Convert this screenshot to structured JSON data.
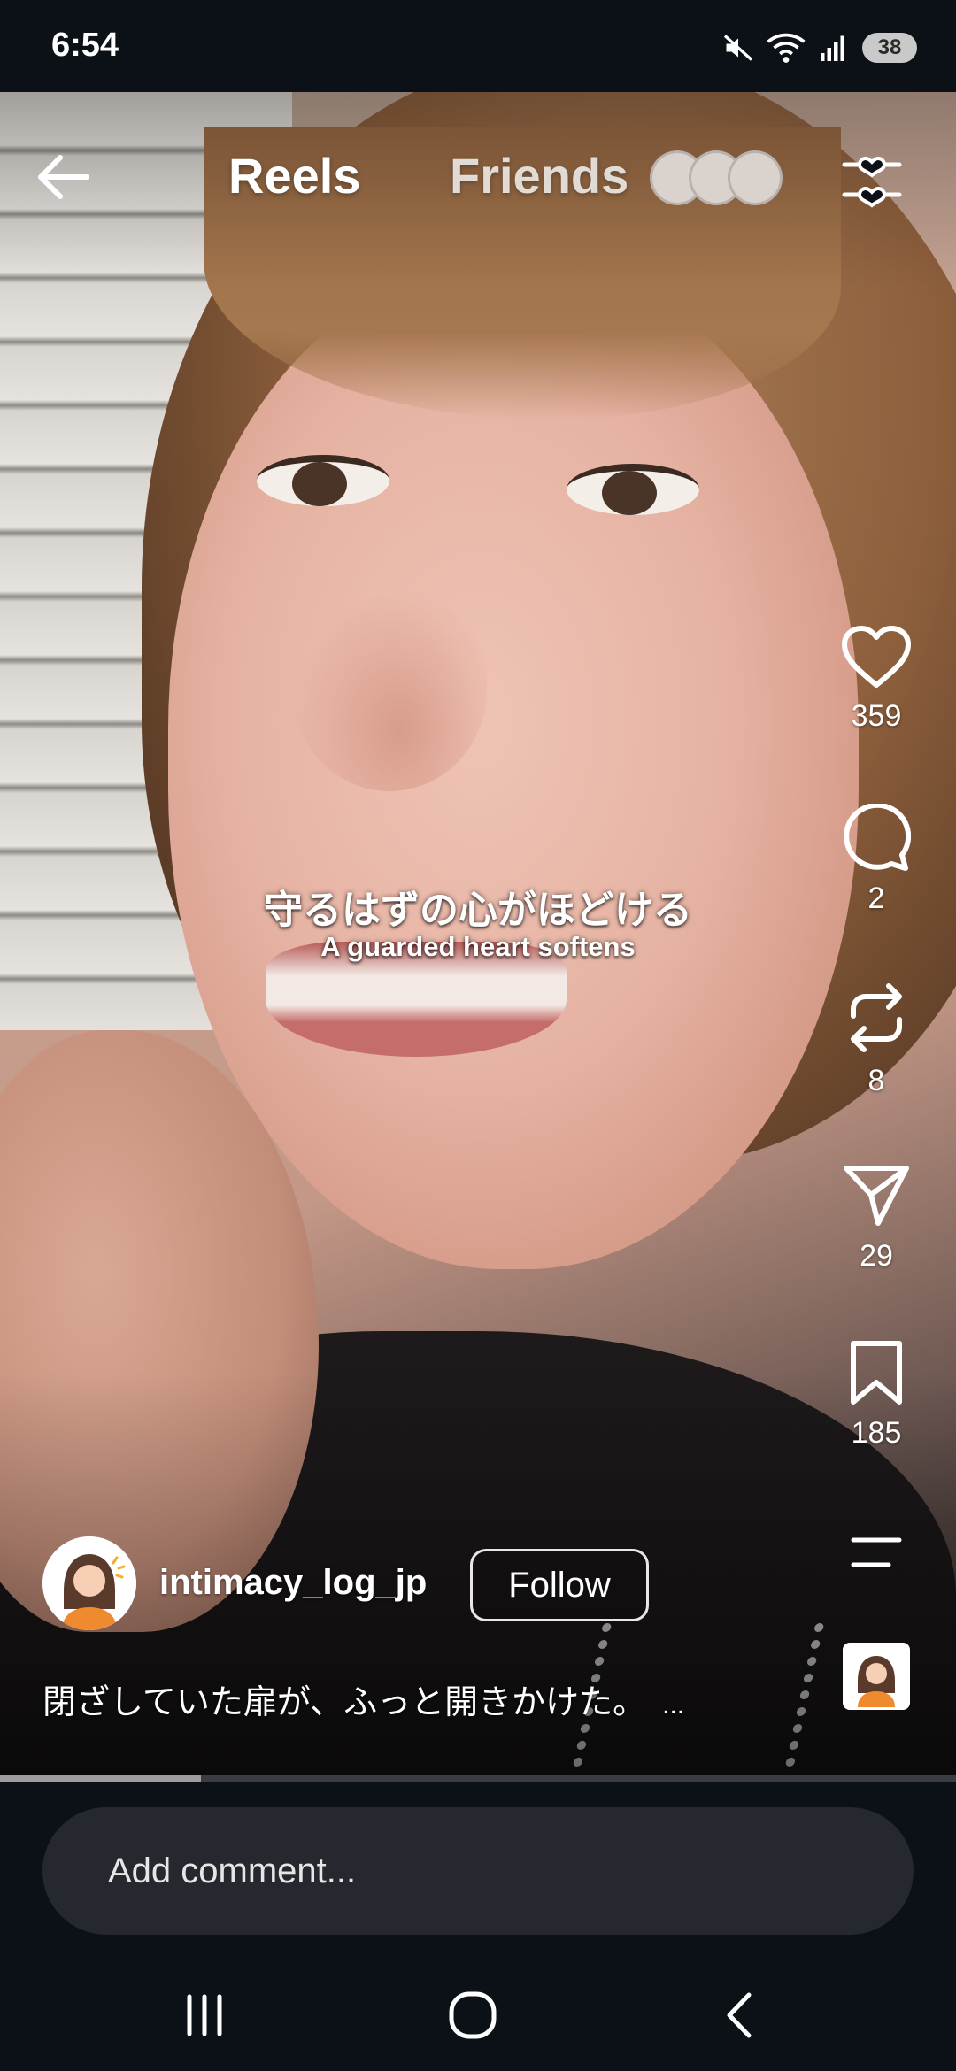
{
  "status_bar": {
    "time": "6:54",
    "battery": "38",
    "icons": [
      "mute-icon",
      "wifi-icon",
      "signal-icon",
      "battery-icon"
    ]
  },
  "top_nav": {
    "tabs": [
      {
        "label": "Reels",
        "active": true
      },
      {
        "label": "Friends",
        "active": false
      }
    ],
    "icons": [
      "back-arrow-icon",
      "friend-avatars",
      "filter-sliders-icon"
    ]
  },
  "video": {
    "caption_jp": "守るはずの心がほどける",
    "caption_en": "A guarded heart softens",
    "progress": 0.21
  },
  "actions": [
    {
      "name": "like",
      "icon": "heart-icon",
      "count": "359"
    },
    {
      "name": "comment",
      "icon": "comment-bubble-icon",
      "count": "2"
    },
    {
      "name": "remix",
      "icon": "repost-icon",
      "count": "8"
    },
    {
      "name": "share",
      "icon": "send-icon",
      "count": "29"
    },
    {
      "name": "save",
      "icon": "bookmark-icon",
      "count": "185"
    }
  ],
  "author": {
    "username": "intimacy_log_jp",
    "follow_label": "Follow",
    "description": "閉ざしていた扉が、ふっと開きかけた。",
    "more": "..."
  },
  "comment": {
    "placeholder": "Add comment..."
  },
  "colors": {
    "background": "#0c1017",
    "comment_field": "#25292f",
    "avatar_shirt": "#f08a2e"
  }
}
